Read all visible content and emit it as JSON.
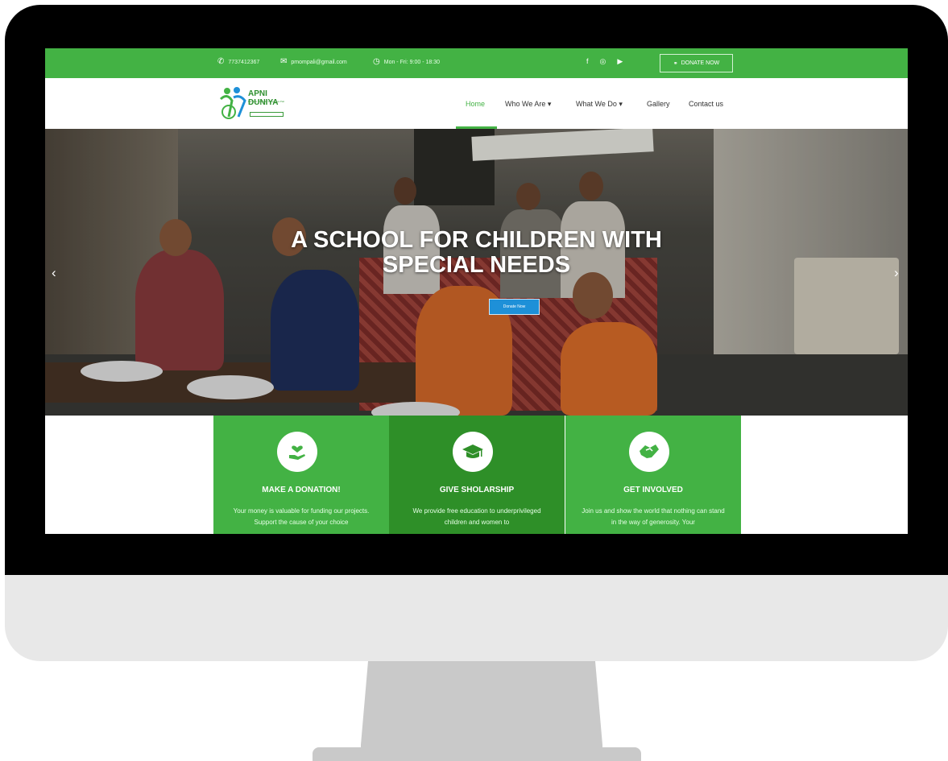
{
  "topbar": {
    "phone": "7737412367",
    "email": "pmompali@gmail.com",
    "hours": "Mon - Fri: 9:00 - 18:30",
    "social_icons": [
      "facebook-icon",
      "instagram-icon",
      "youtube-icon"
    ],
    "donate_label": "DONATE NOW"
  },
  "logo": {
    "name": "APNI DUNIYA",
    "subtitle": "Manshik Vimandit Vidhyalaya Pali"
  },
  "nav": {
    "items": [
      {
        "label": "Home",
        "active": true
      },
      {
        "label": "Who We Are",
        "dropdown": true
      },
      {
        "label": "What We Do",
        "dropdown": true
      },
      {
        "label": "Gallery"
      },
      {
        "label": "Contact us"
      }
    ]
  },
  "hero": {
    "title_line1": "A SCHOOL FOR CHILDREN WITH",
    "title_line2": "SPECIAL NEEDS",
    "button_label": "Donate Now"
  },
  "features": [
    {
      "title": "MAKE A DONATION!",
      "desc": "Your money is valuable for funding our projects. Support the cause of your choice",
      "icon": "heart-hand-icon",
      "color": "#43b244"
    },
    {
      "title": "GIVE SHOLARSHIP",
      "desc": "We provide free education to underprivileged children and women to",
      "icon": "graduation-cap-icon",
      "color": "#2e8f28"
    },
    {
      "title": "GET INVOLVED",
      "desc": "Join us and show the world that nothing can stand in the way of generosity. Your",
      "icon": "handshake-icon",
      "color": "#43b244"
    }
  ],
  "colors": {
    "brand_green": "#43b244",
    "dark_green": "#2e8f28",
    "button_blue": "#1e90d8"
  }
}
